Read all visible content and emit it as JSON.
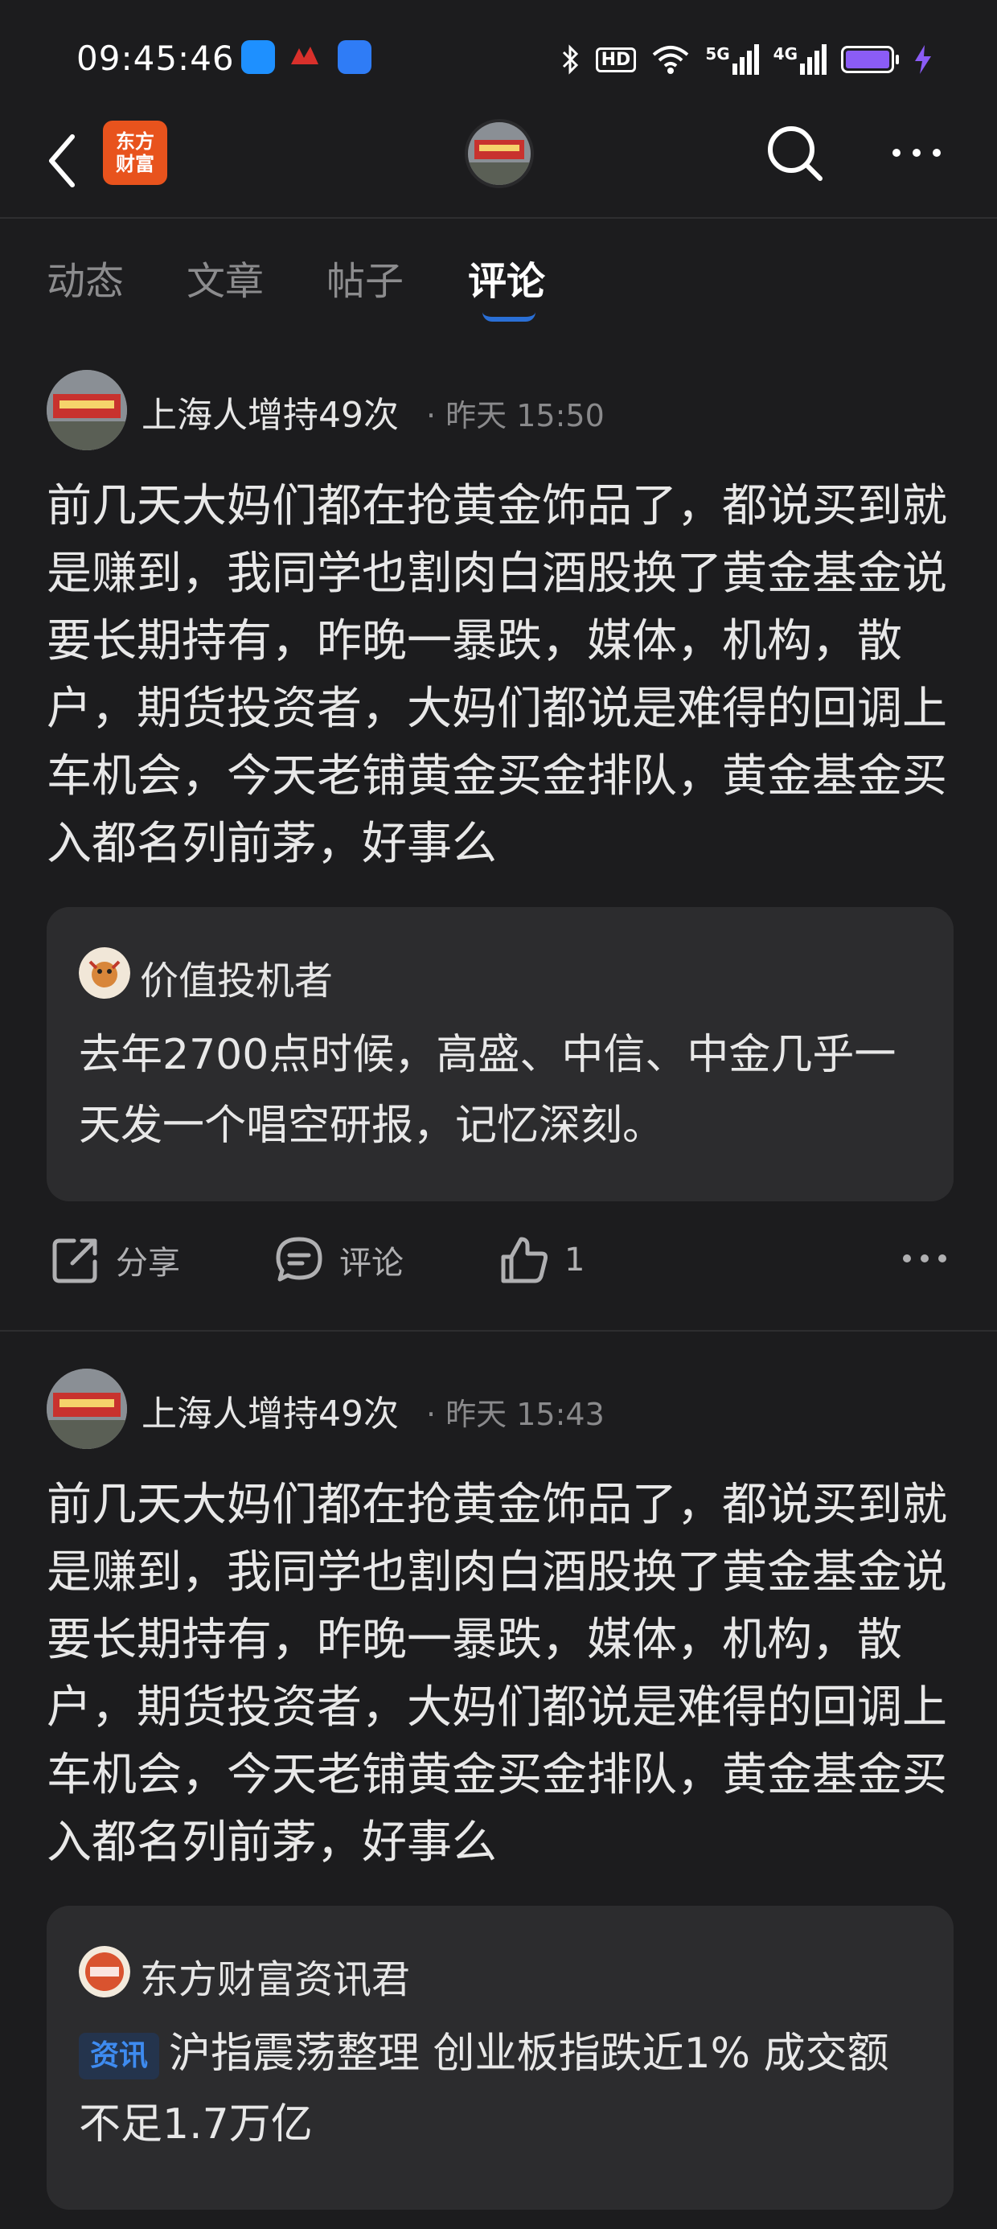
{
  "status_bar": {
    "time": "09:45:46",
    "network_hd": "HD",
    "signal_1": "5G",
    "signal_2": "4G"
  },
  "nav": {
    "logo_line1": "东方",
    "logo_line2": "财富"
  },
  "tabs": [
    {
      "label": "动态"
    },
    {
      "label": "文章"
    },
    {
      "label": "帖子"
    },
    {
      "label": "评论"
    }
  ],
  "posts": [
    {
      "username": "上海人增持49次",
      "meta": "· 昨天 15:50",
      "text": "前几天大妈们都在抢黄金饰品了，都说买到就是赚到，我同学也割肉白酒股换了黄金基金说要长期持有，昨晚一暴跌，媒体，机构，散户，期货投资者，大妈们都说是难得的回调上车机会，今天老铺黄金买金排队，黄金基金买入都名列前茅，好事么",
      "quote": {
        "name": "价值投机者",
        "text": "去年2700点时候，高盛、中信、中金几乎一天发一个唱空研报，记忆深刻。"
      },
      "actions": {
        "share": "分享",
        "comment": "评论",
        "like_count": "1"
      }
    },
    {
      "username": "上海人增持49次",
      "meta": "· 昨天 15:43",
      "text": "前几天大妈们都在抢黄金饰品了，都说买到就是赚到，我同学也割肉白酒股换了黄金基金说要长期持有，昨晚一暴跌，媒体，机构，散户，期货投资者，大妈们都说是难得的回调上车机会，今天老铺黄金买金排队，黄金基金买入都名列前茅，好事么",
      "quote": {
        "name": "东方财富资讯君",
        "badge": "资讯",
        "text": "沪指震荡整理 创业板指跌近1% 成交额不足1.7万亿"
      }
    }
  ],
  "colors": {
    "background": "#1c1c1e",
    "card": "#2c2c2e",
    "accent": "#2a6fd6",
    "brand": "#e8531d",
    "battery": "#8b5cf6"
  }
}
